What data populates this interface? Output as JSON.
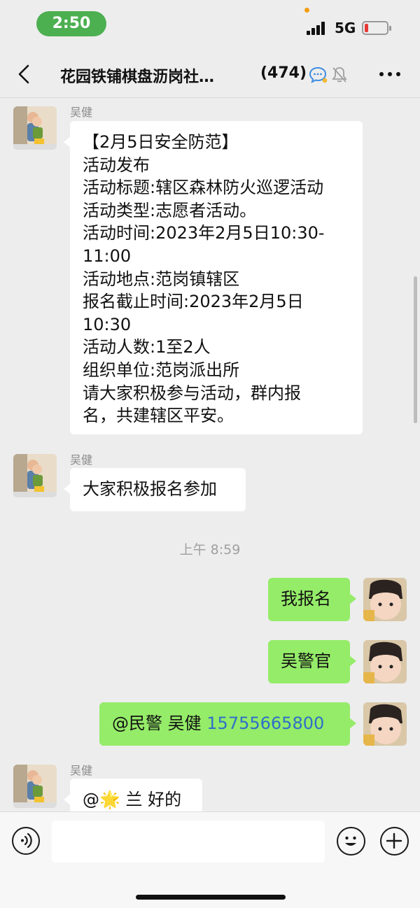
{
  "status_bar": {
    "time": "2:50",
    "network": "5G"
  },
  "header": {
    "title": "花园铁铺棋盘沥岗社…",
    "count": "(474)"
  },
  "messages": [
    {
      "sender": "吴健",
      "lines": [
        "【2月5日安全防范】",
        "活动发布",
        "活动标题:辖区森林防火巡逻活动",
        "活动类型:志愿者活动。",
        "活动时间:2023年2月5日10:30-",
        "11:00",
        "活动地点:范岗镇辖区",
        "报名截止时间:2023年2月5日",
        "10:30",
        "活动人数:1至2人",
        "组织单位:范岗派出所",
        "请大家积极参与活动，群内报",
        "名，共建辖区平安。"
      ]
    },
    {
      "sender": "吴健",
      "text": "大家积极报名参加"
    },
    {
      "timestamp": "上午 8:59"
    },
    {
      "text": "我报名"
    },
    {
      "text": "吴警官"
    },
    {
      "mention": "@民警 吴健",
      "phone": "15755665800"
    },
    {
      "sender": "吴健",
      "text": "@🌟 兰 好的"
    }
  ],
  "colors": {
    "outgoing_bubble": "#95ec69",
    "incoming_bubble": "#ffffff",
    "time_pill": "#4caf50",
    "phone_link": "#2e6fc8"
  }
}
